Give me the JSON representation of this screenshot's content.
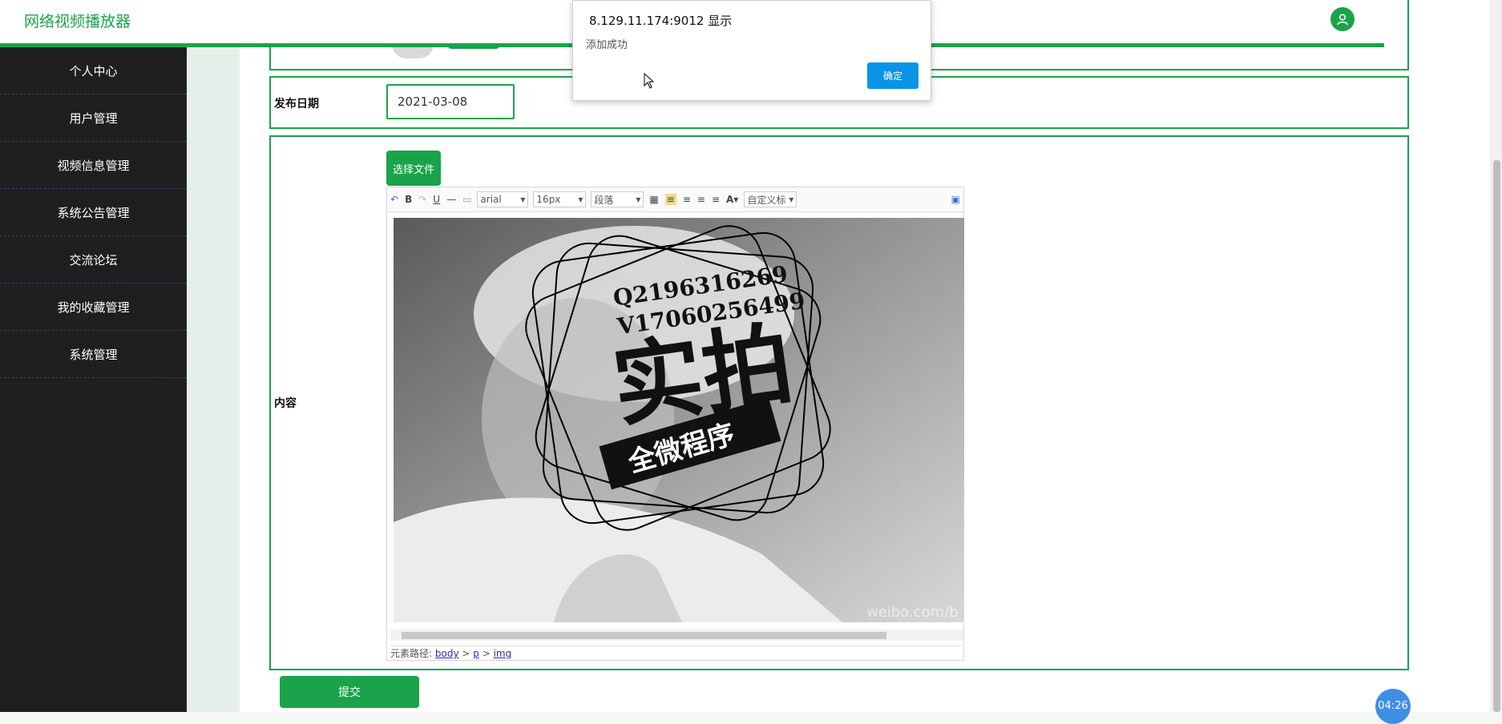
{
  "app": {
    "title": "网络视频播放器"
  },
  "sidebar": {
    "items": [
      {
        "label": "个人中心"
      },
      {
        "label": "用户管理"
      },
      {
        "label": "视频信息管理"
      },
      {
        "label": "系统公告管理"
      },
      {
        "label": "交流论坛"
      },
      {
        "label": "我的收藏管理"
      },
      {
        "label": "系统管理"
      }
    ]
  },
  "form": {
    "date_label": "发布日期",
    "date_value": "2021-03-08",
    "content_label": "内容",
    "choose_file": "选择文件",
    "submit": "提交"
  },
  "editor": {
    "font_name": "arial",
    "font_size": "16px",
    "paragraph": "段落",
    "custom_title": "自定义标",
    "path_label": "元素路径:",
    "path": [
      "body",
      "p",
      "img"
    ]
  },
  "image_overlay": {
    "line1": "Q2196316269",
    "line2": "V17060256499",
    "big_text": "实拍",
    "banner_text": "全微程序",
    "watermark": "weibo.com/b"
  },
  "dialog": {
    "title": "8.129.11.174:9012 显示",
    "message": "添加成功",
    "ok": "确定"
  },
  "clock": "04:26",
  "colors": {
    "accent": "#1aa34a",
    "sidebar_bg": "#1e1f1e",
    "dialog_ok": "#0a94e6"
  }
}
